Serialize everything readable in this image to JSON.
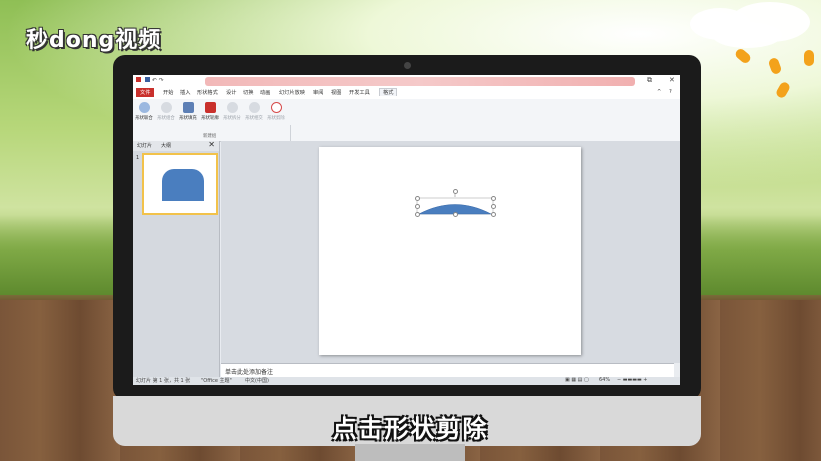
{
  "watermark": {
    "logo_text": "秒dong视频"
  },
  "app": {
    "title_blurred": true,
    "file_tab": "文件",
    "tabs": [
      "开始",
      "插入",
      "形状格式",
      "设计",
      "切换",
      "动画",
      "幻灯片放映",
      "审阅",
      "视图",
      "开发工具",
      "格式"
    ],
    "active_tab": "格式",
    "window_controls": {
      "restore": "⧉",
      "close": "✕",
      "help": "?",
      "minimize_ribbon": "^"
    },
    "ribbon": {
      "buttons": [
        {
          "label": "形状联合",
          "enabled": true
        },
        {
          "label": "形状组合",
          "enabled": false
        },
        {
          "label": "形状填充",
          "enabled": true
        },
        {
          "label": "形状轮廓",
          "enabled": true
        },
        {
          "label": "形状拆分",
          "enabled": false
        },
        {
          "label": "形状相交",
          "enabled": false
        },
        {
          "label": "形状剪除",
          "enabled": false
        }
      ],
      "group_label": "新建组"
    },
    "left_pane": {
      "tabs": [
        "幻灯片",
        "大纲"
      ],
      "close": "✕",
      "slide_number": "1"
    },
    "notes_placeholder": "单击此处添加备注",
    "status": {
      "slide_info": "幻灯片 第 1 张，共 1 张",
      "theme": "\"Office 主题\"",
      "language": "中文(中国)",
      "zoom": "64%"
    },
    "colors": {
      "shape": "#4a7ebf",
      "file_tab": "#c9302c",
      "thumb_border": "#f2c24a"
    }
  },
  "caption": "点击形状剪除"
}
